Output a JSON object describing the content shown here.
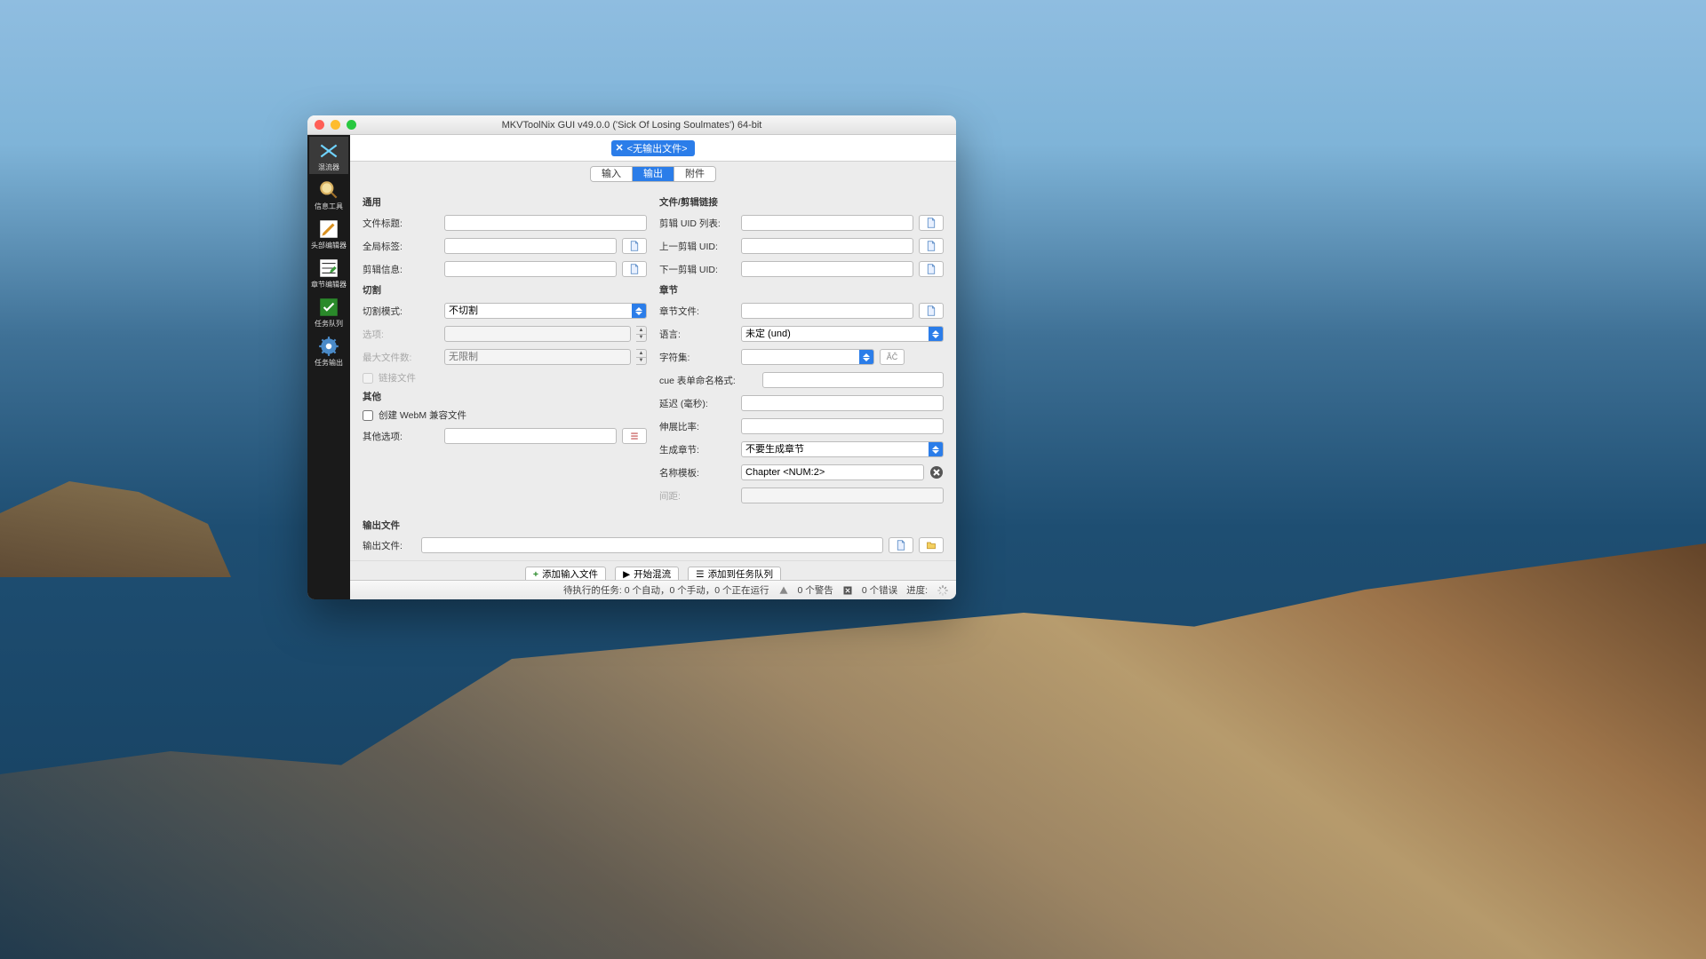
{
  "window": {
    "title": "MKVToolNix GUI v49.0.0 ('Sick Of Losing Soulmates') 64-bit"
  },
  "sidebar": {
    "items": [
      {
        "label": "混流器"
      },
      {
        "label": "信息工具"
      },
      {
        "label": "头部编辑器"
      },
      {
        "label": "章节编辑器"
      },
      {
        "label": "任务队列"
      },
      {
        "label": "任务输出"
      }
    ]
  },
  "output_chip": {
    "text": "<无输出文件>"
  },
  "tabs": {
    "input": "输入",
    "output": "输出",
    "attachments": "附件"
  },
  "general": {
    "title": "通用",
    "file_title_label": "文件标题:",
    "global_tags_label": "全局标签:",
    "segment_info_label": "剪辑信息:"
  },
  "split": {
    "title": "切割",
    "mode_label": "切割模式:",
    "mode_value": "不切割",
    "option_label": "选项:",
    "maxfiles_label": "最大文件数:",
    "maxfiles_placeholder": "无限制",
    "linkfiles_label": "链接文件"
  },
  "misc": {
    "title": "其他",
    "webm_label": "创建 WebM 兼容文件",
    "other_options_label": "其他选项:"
  },
  "links": {
    "title": "文件/剪辑链接",
    "seg_uid_label": "剪辑 UID 列表:",
    "prev_uid_label": "上一剪辑 UID:",
    "next_uid_label": "下一剪辑 UID:"
  },
  "chapters": {
    "title": "章节",
    "file_label": "章节文件:",
    "lang_label": "语言:",
    "lang_value": "未定 (und)",
    "charset_label": "字符集:",
    "cuename_label": "cue 表单命名格式:",
    "delay_label": "延迟 (毫秒):",
    "stretch_label": "伸展比率:",
    "gen_label": "生成章节:",
    "gen_value": "不要生成章节",
    "template_label": "名称模板:",
    "template_value": "Chapter <NUM:2>",
    "interval_label": "间距:"
  },
  "output_file": {
    "title": "输出文件",
    "label": "输出文件:"
  },
  "actions": {
    "add_src": "添加输入文件",
    "start_mux": "开始混流",
    "add_queue": "添加到任务队列"
  },
  "status": {
    "pending": "待执行的任务: 0 个自动，0 个手动，0 个正在运行",
    "warnings": "0 个警告",
    "errors": "0 个错误",
    "progress": "进度:"
  }
}
